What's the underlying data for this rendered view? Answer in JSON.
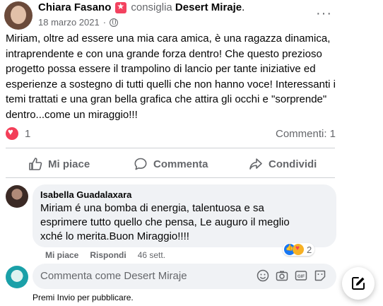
{
  "post": {
    "author": "Chiara Fasano",
    "recommends_label": "consiglia",
    "page": "Desert Miraje",
    "period": ".",
    "date": "18 marzo 2021",
    "date_sep": "·",
    "more": "···",
    "text": "Miriam, oltre ad essere una mia cara amica, è una ragazza dinamica, intraprendente e con una grande forza dentro! Che questo prezioso progetto possa essere il trampolino di lancio per tante iniziative ed esperienze a sostegno di tutti quelli che non hanno voce! Interessanti i temi trattati e una gran bella grafica che attira gli occhi e \"sorprende\" dentro...come un miraggio!!!"
  },
  "reactions": {
    "count": "1",
    "comments": "Commenti: 1"
  },
  "actions": {
    "like": "Mi piace",
    "comment": "Commenta",
    "share": "Condividi"
  },
  "comment": {
    "author": "Isabella Guadalaxara",
    "text": "Miriam é una bomba di energia, talentuosa e sa esprimere tutto quello che pensa, Le auguro il meglio xché lo merita.Buon Miraggio!!!!",
    "like": "Mi piace",
    "reply": "Rispondi",
    "time": "46 sett.",
    "reactions": "2"
  },
  "composer": {
    "placeholder": "Commenta come Desert Miraje",
    "hint": "Premi Invio per pubblicare."
  },
  "colors": {
    "accent": "#1877f2",
    "love": "#f33e58",
    "muted": "#65676b"
  }
}
